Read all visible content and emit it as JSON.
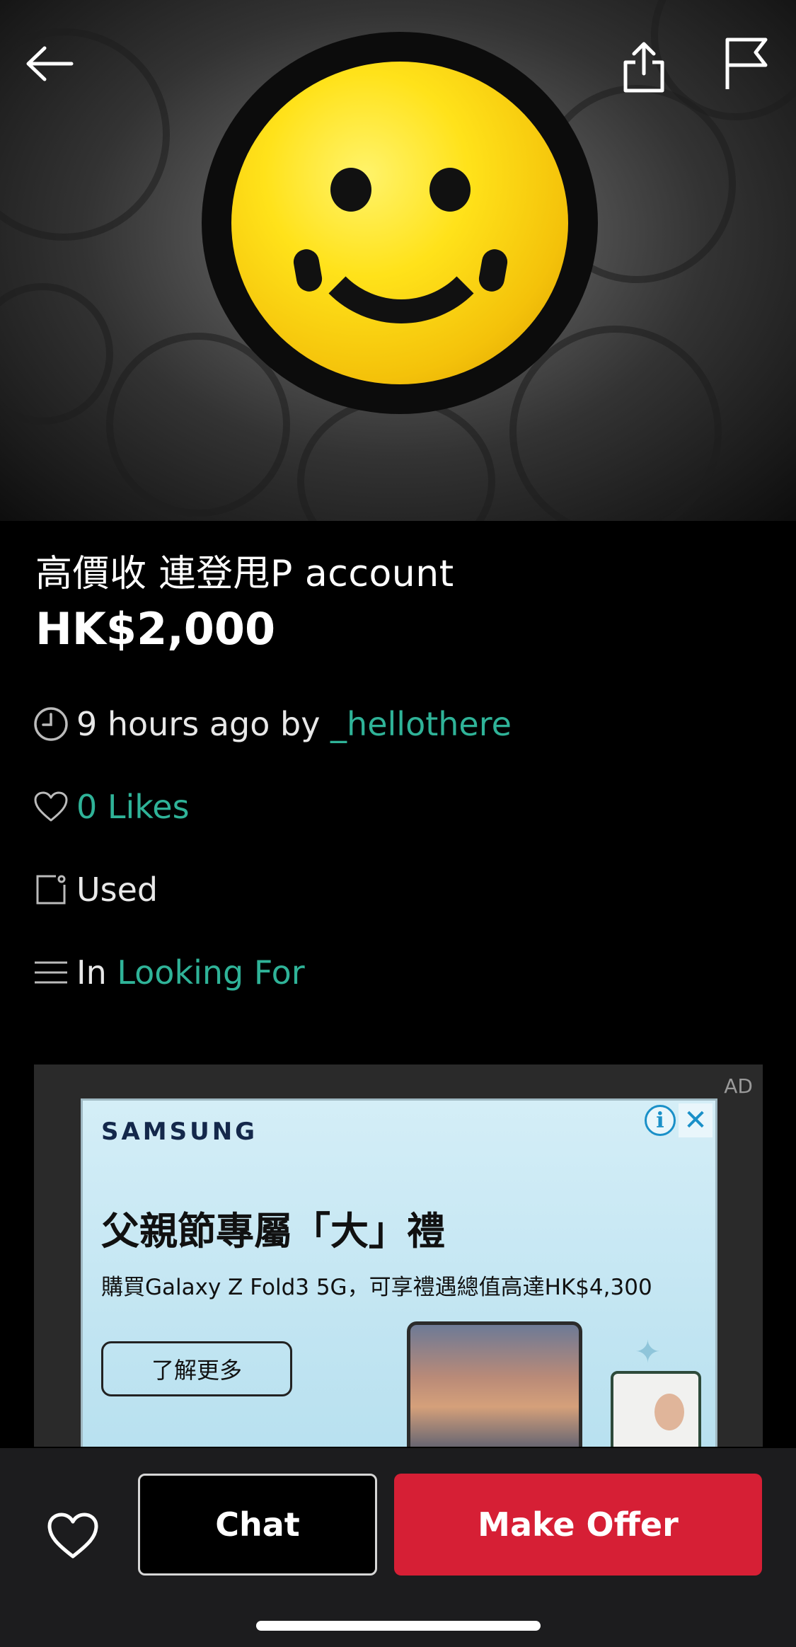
{
  "header": {
    "back_icon": "arrow-left-icon",
    "share_icon": "share-icon",
    "report_icon": "flag-icon"
  },
  "listing": {
    "title": "高價收 連登甩P account",
    "price": "HK$2,000",
    "posted_time": "9 hours ago by ",
    "seller": "_hellothere",
    "likes": "0 Likes",
    "condition": "Used",
    "category_prefix": "In ",
    "category": "Looking For"
  },
  "ad": {
    "tag": "AD",
    "brand": "SAMSUNG",
    "headline": "父親節專屬「大」禮",
    "subtext": "購買Galaxy Z Fold3 5G，可享禮遇總值高達HK$4,300",
    "cta": "了解更多",
    "info_icon": "i",
    "close_icon": "✕"
  },
  "actions": {
    "chat_label": "Chat",
    "offer_label": "Make Offer"
  },
  "colors": {
    "accent_green": "#2fb398",
    "offer_red": "#d61f35",
    "background": "#000000",
    "bottom_bar": "#1c1c1e"
  }
}
